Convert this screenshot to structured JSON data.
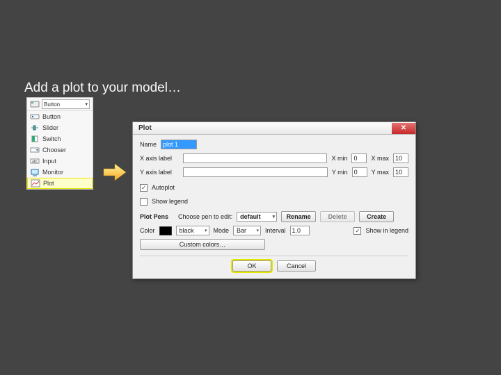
{
  "heading": "Add a plot to your model…",
  "toolbar": {
    "header_button": "Button",
    "items": [
      {
        "label": "Button"
      },
      {
        "label": "Slider"
      },
      {
        "label": "Switch"
      },
      {
        "label": "Chooser"
      },
      {
        "label": "Input"
      },
      {
        "label": "Monitor"
      },
      {
        "label": "Plot"
      }
    ]
  },
  "dialog": {
    "title": "Plot",
    "name_label": "Name",
    "name_value": "plot 1",
    "xaxis_label": "X axis label",
    "yaxis_label": "Y axis label",
    "xmin_label": "X min",
    "xmin_value": "0",
    "xmax_label": "X max",
    "xmax_value": "10",
    "ymin_label": "Y min",
    "ymin_value": "0",
    "ymax_label": "Y max",
    "ymax_value": "10",
    "autoplot_label": "Autoplot",
    "legend_label": "Show legend",
    "plotpens_heading": "Plot Pens",
    "choose_pen_label": "Choose pen to edit:",
    "pen_default": "default",
    "rename_btn": "Rename",
    "delete_btn": "Delete",
    "create_btn": "Create",
    "color_label": "Color",
    "color_name": "black",
    "mode_label": "Mode",
    "mode_value": "Bar",
    "interval_label": "Interval",
    "interval_value": "1.0",
    "showlegend_label": "Show in legend",
    "custom_colors_btn": "Custom colors…",
    "ok_btn": "OK",
    "cancel_btn": "Cancel"
  }
}
